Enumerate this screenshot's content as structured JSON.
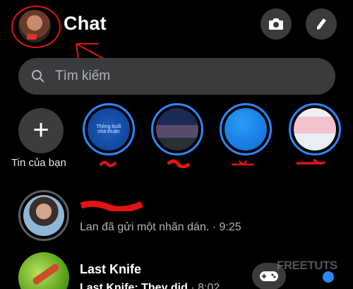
{
  "header": {
    "title": "Chat",
    "avatar_icon": "profile-avatar",
    "camera_icon": "camera-icon",
    "compose_icon": "pencil-icon"
  },
  "search": {
    "placeholder": "Tìm kiếm",
    "icon": "search-icon"
  },
  "stories": {
    "add_label": "Tin của bạn",
    "add_icon": "plus-icon",
    "items": [
      {
        "thumb_text": "Thông buổi nhà thuận"
      },
      {
        "thumb_text": ""
      },
      {
        "thumb_text": ""
      },
      {
        "thumb_text": ""
      }
    ]
  },
  "chats": [
    {
      "name": "",
      "preview": "Lan đã gửi một nhãn dán. · 9:25"
    },
    {
      "name": "Last Knife",
      "preview": "Last Knife: They did",
      "time": "· 8:02"
    }
  ],
  "bottom": {
    "game_icon": "gamepad-icon",
    "watermark": "FREETUTS"
  },
  "colors": {
    "background": "#000000",
    "surface": "#3a3b3c",
    "accent": "#2d88ff",
    "annotation": "#e01414",
    "muted_text": "#b0b3b8"
  }
}
